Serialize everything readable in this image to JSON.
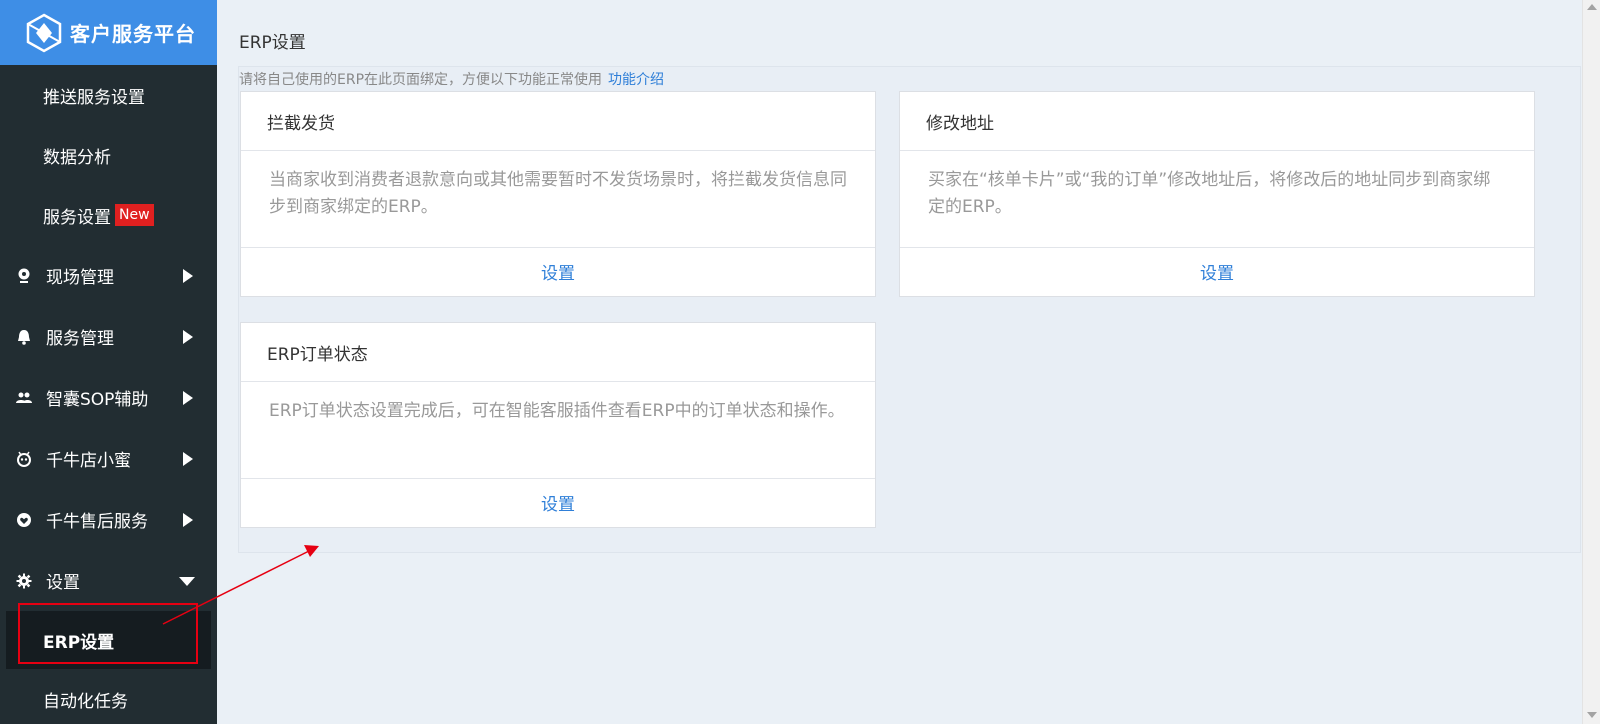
{
  "sidebar": {
    "app_title": "客户服务平台",
    "items": [
      {
        "label": "推送服务设置"
      },
      {
        "label": "数据分析"
      },
      {
        "label": "服务设置",
        "badge": "New"
      },
      {
        "label": "现场管理",
        "icon": "location-icon"
      },
      {
        "label": "服务管理",
        "icon": "bell-icon"
      },
      {
        "label": "智囊SOP辅助",
        "icon": "users-icon"
      },
      {
        "label": "千牛店小蜜",
        "icon": "robot-icon"
      },
      {
        "label": "千牛售后服务",
        "icon": "heart-icon"
      },
      {
        "label": "设置",
        "icon": "gear-icon"
      },
      {
        "label": "ERP设置",
        "active": true
      },
      {
        "label": "自动化任务"
      }
    ]
  },
  "main": {
    "title": "ERP设置",
    "hint": "请将自己使用的ERP在此页面绑定，方便以下功能正常使用",
    "hint_link": "功能介绍",
    "cards": [
      {
        "title": "拦截发货",
        "desc": "当商家收到消费者退款意向或其他需要暂时不发货场景时，将拦截发货信息同步到商家绑定的ERP。",
        "action": "设置"
      },
      {
        "title": "修改地址",
        "desc": "买家在“核单卡片”或“我的订单”修改地址后，将修改后的地址同步到商家绑定的ERP。",
        "action": "设置"
      },
      {
        "title": "ERP订单状态",
        "desc": "ERP订单状态设置完成后，可在智能客服插件查看ERP中的订单状态和操作。",
        "action": "设置"
      }
    ]
  },
  "colors": {
    "sidebar_bg": "#222d32",
    "logo_bg": "#3e8ee6",
    "link": "#2f7fd8",
    "badge": "#e02020",
    "annotation": "#e60012"
  }
}
